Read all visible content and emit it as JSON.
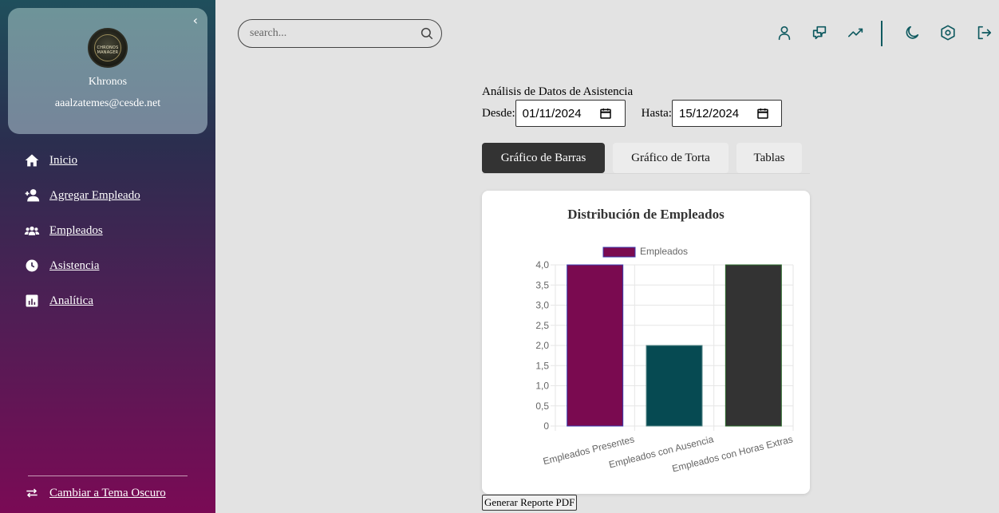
{
  "sidebar": {
    "collapse_icon": "chevron-left-icon",
    "logo_text": "CHRONOS MANAGER",
    "profile_name": "Khronos",
    "profile_email": "aaalzatemes@cesde.net",
    "items": [
      {
        "label": "Inicio",
        "icon": "home-icon"
      },
      {
        "label": "Agregar Empleado",
        "icon": "user-plus-icon"
      },
      {
        "label": "Empleados",
        "icon": "users-icon"
      },
      {
        "label": "Asistencia",
        "icon": "clock-icon"
      },
      {
        "label": "Analítica",
        "icon": "chart-icon"
      }
    ],
    "theme_toggle_label": "Cambiar a Tema Oscuro",
    "theme_toggle_icon": "swap-icon"
  },
  "header": {
    "search_placeholder": "search...",
    "icons": [
      "user-icon",
      "chat-icon",
      "trend-icon",
      "moon-icon",
      "settings-icon",
      "logout-icon"
    ]
  },
  "main": {
    "analysis_title": "Análisis de Datos de Asistencia",
    "from_label": "Desde:",
    "from_value": "01/11/2024",
    "to_label": "Hasta:",
    "to_value": "15/12/2024",
    "tabs": [
      {
        "label": "Gráfico de Barras",
        "active": true
      },
      {
        "label": "Gráfico de Torta",
        "active": false
      },
      {
        "label": "Tablas",
        "active": false
      }
    ],
    "pdf_button": "Generar Reporte PDF"
  },
  "colors": {
    "accent": "#0f5a60",
    "bar_present": "#7a0a50",
    "bar_absent": "#064a52",
    "bar_overtime": "#333333"
  },
  "chart_data": {
    "type": "bar",
    "title": "Distribución de Empleados",
    "legend": "Empleados",
    "legend_position": "top",
    "categories": [
      "Empleados Presentes",
      "Empleados con Ausencia",
      "Empleados con Horas Extras"
    ],
    "values": [
      4,
      2,
      4
    ],
    "ylim": [
      0,
      4
    ],
    "yticks": [
      "0",
      "0,5",
      "1,0",
      "1,5",
      "2,0",
      "2,5",
      "3,0",
      "3,5",
      "4,0"
    ],
    "grid": true
  }
}
